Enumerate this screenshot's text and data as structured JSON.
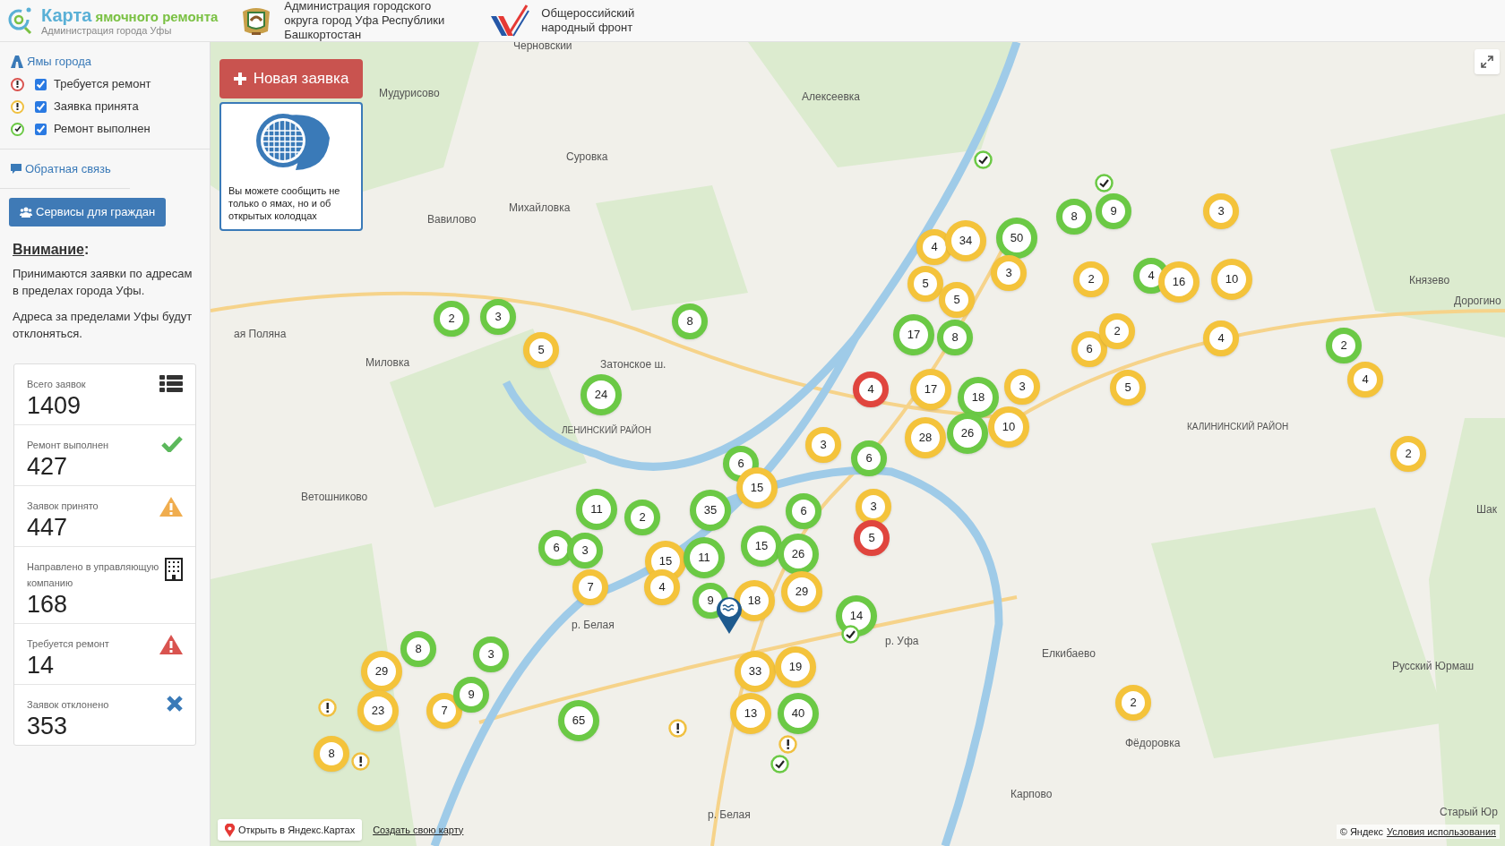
{
  "header": {
    "app_title": "Карта",
    "app_title_accent": "ямочного ремонта",
    "app_subtitle": "Администрация города Уфы",
    "partners": [
      {
        "kind": "coat",
        "text": "Администрация городского округа город Уфа Республики Башкортостан"
      },
      {
        "kind": "onf",
        "text": "Общероссийский народный фронт"
      }
    ]
  },
  "sidebar": {
    "layers_title": "Ямы города",
    "legend": [
      {
        "kind": "needs",
        "label": "Требуется ремонт",
        "checked": true
      },
      {
        "kind": "accepted",
        "label": "Заявка принята",
        "checked": true
      },
      {
        "kind": "done",
        "label": "Ремонт выполнен",
        "checked": true
      }
    ],
    "feedback_link": "Обратная связь",
    "services_button": "Сервисы для граждан",
    "notice_title": "Внимание",
    "notice_colon": ":",
    "notice_paragraphs": [
      "Принимаются заявки по адресам в пределах города Уфы.",
      "Адреса за пределами Уфы будут отклоняться."
    ],
    "stats": [
      {
        "kind": "list",
        "label": "Всего заявок",
        "value": "1409"
      },
      {
        "kind": "check",
        "label": "Ремонт выполнен",
        "value": "427"
      },
      {
        "kind": "warn",
        "label": "Заявок принято",
        "value": "447"
      },
      {
        "kind": "building",
        "label": "Направлено в управляющую компанию",
        "value": "168"
      },
      {
        "kind": "alert",
        "label": "Требуется ремонт",
        "value": "14"
      },
      {
        "kind": "cross",
        "label": "Заявок отклонено",
        "value": "353"
      }
    ]
  },
  "map": {
    "new_request_button": "Новая заявка",
    "hint_text": "Вы можете сообщить не только о ямах, но и об открытых колодцах",
    "place_labels": [
      {
        "text": "Черновский"
      },
      {
        "text": "Мудурисово"
      },
      {
        "text": "Алексеевка"
      },
      {
        "text": "Суровка"
      },
      {
        "text": "Михайловка"
      },
      {
        "text": "Вавилово"
      },
      {
        "text": "ая Поляна"
      },
      {
        "text": "Миловка"
      },
      {
        "text": "Ветошниково"
      },
      {
        "text": "Князево"
      },
      {
        "text": "Дорогино"
      },
      {
        "text": "Елкибаево"
      },
      {
        "text": "Русский Юрмаш"
      },
      {
        "text": "Фёдоровка"
      },
      {
        "text": "Карпово"
      },
      {
        "text": "Шак"
      },
      {
        "text": "Старый Юр"
      },
      {
        "text": "ЛЕНИНСКИЙ РАЙОН"
      },
      {
        "text": "КАЛИНИНСКИЙ РАЙОН"
      },
      {
        "text": "р. Белая"
      },
      {
        "text": "р. Белая"
      },
      {
        "text": "р. Уфа"
      },
      {
        "text": "Затонское ш."
      }
    ],
    "clusters": [
      {
        "count": "2",
        "color": "#6bc945"
      },
      {
        "count": "3",
        "color": "#6bc945"
      },
      {
        "count": "5",
        "color": "#f4c33b"
      },
      {
        "count": "8",
        "color": "#6bc945"
      },
      {
        "count": "24",
        "color": "#6bc945"
      },
      {
        "count": "8",
        "color": "#6bc945"
      },
      {
        "count": "9",
        "color": "#6bc945"
      },
      {
        "count": "3",
        "color": "#f4c33b"
      },
      {
        "count": "4",
        "color": "#f4c33b"
      },
      {
        "count": "34",
        "color": "#f4c33b"
      },
      {
        "count": "50",
        "color": "#6bc945"
      },
      {
        "count": "5",
        "color": "#f4c33b"
      },
      {
        "count": "3",
        "color": "#f4c33b"
      },
      {
        "count": "2",
        "color": "#f4c33b"
      },
      {
        "count": "4",
        "color": "#6bc945"
      },
      {
        "count": "16",
        "color": "#f4c33b"
      },
      {
        "count": "10",
        "color": "#f4c33b"
      },
      {
        "count": "5",
        "color": "#f4c33b"
      },
      {
        "count": "17",
        "color": "#6bc945"
      },
      {
        "count": "8",
        "color": "#6bc945"
      },
      {
        "count": "6",
        "color": "#f4c33b"
      },
      {
        "count": "2",
        "color": "#f4c33b"
      },
      {
        "count": "4",
        "color": "#f4c33b"
      },
      {
        "count": "2",
        "color": "#6bc945"
      },
      {
        "count": "4",
        "color": "#e0453e"
      },
      {
        "count": "17",
        "color": "#f4c33b"
      },
      {
        "count": "18",
        "color": "#6bc945"
      },
      {
        "count": "3",
        "color": "#f4c33b"
      },
      {
        "count": "5",
        "color": "#f4c33b"
      },
      {
        "count": "4",
        "color": "#f4c33b"
      },
      {
        "count": "6",
        "color": "#6bc945"
      },
      {
        "count": "3",
        "color": "#f4c33b"
      },
      {
        "count": "6",
        "color": "#6bc945"
      },
      {
        "count": "28",
        "color": "#f4c33b"
      },
      {
        "count": "26",
        "color": "#6bc945"
      },
      {
        "count": "10",
        "color": "#f4c33b"
      },
      {
        "count": "2",
        "color": "#f4c33b"
      },
      {
        "count": "15",
        "color": "#f4c33b"
      },
      {
        "count": "11",
        "color": "#6bc945"
      },
      {
        "count": "2",
        "color": "#6bc945"
      },
      {
        "count": "35",
        "color": "#6bc945"
      },
      {
        "count": "6",
        "color": "#6bc945"
      },
      {
        "count": "3",
        "color": "#f4c33b"
      },
      {
        "count": "6",
        "color": "#6bc945"
      },
      {
        "count": "3",
        "color": "#6bc945"
      },
      {
        "count": "15",
        "color": "#f4c33b"
      },
      {
        "count": "11",
        "color": "#6bc945"
      },
      {
        "count": "15",
        "color": "#6bc945"
      },
      {
        "count": "26",
        "color": "#6bc945"
      },
      {
        "count": "5",
        "color": "#e0453e"
      },
      {
        "count": "7",
        "color": "#f4c33b"
      },
      {
        "count": "4",
        "color": "#f4c33b"
      },
      {
        "count": "9",
        "color": "#6bc945"
      },
      {
        "count": "18",
        "color": "#f4c33b"
      },
      {
        "count": "29",
        "color": "#f4c33b"
      },
      {
        "count": "14",
        "color": "#6bc945"
      },
      {
        "count": "29",
        "color": "#f4c33b"
      },
      {
        "count": "8",
        "color": "#6bc945"
      },
      {
        "count": "3",
        "color": "#6bc945"
      },
      {
        "count": "33",
        "color": "#f4c33b"
      },
      {
        "count": "19",
        "color": "#f4c33b"
      },
      {
        "count": "23",
        "color": "#f4c33b"
      },
      {
        "count": "7",
        "color": "#f4c33b"
      },
      {
        "count": "9",
        "color": "#6bc945"
      },
      {
        "count": "65",
        "color": "#6bc945"
      },
      {
        "count": "13",
        "color": "#f4c33b"
      },
      {
        "count": "40",
        "color": "#6bc945"
      },
      {
        "count": "2",
        "color": "#f4c33b"
      },
      {
        "count": "8",
        "color": "#f4c33b"
      }
    ],
    "single_markers": [
      {
        "kind": "done"
      },
      {
        "kind": "done"
      },
      {
        "kind": "done"
      },
      {
        "kind": "done"
      },
      {
        "kind": "accepted"
      },
      {
        "kind": "accepted"
      },
      {
        "kind": "accepted"
      },
      {
        "kind": "accepted"
      }
    ],
    "open_in_maps_button": "Открыть в Яндекс.Картах",
    "create_map_link": "Создать свою карту",
    "copyright": "© Яндекс",
    "terms_link": "Условия использования"
  }
}
